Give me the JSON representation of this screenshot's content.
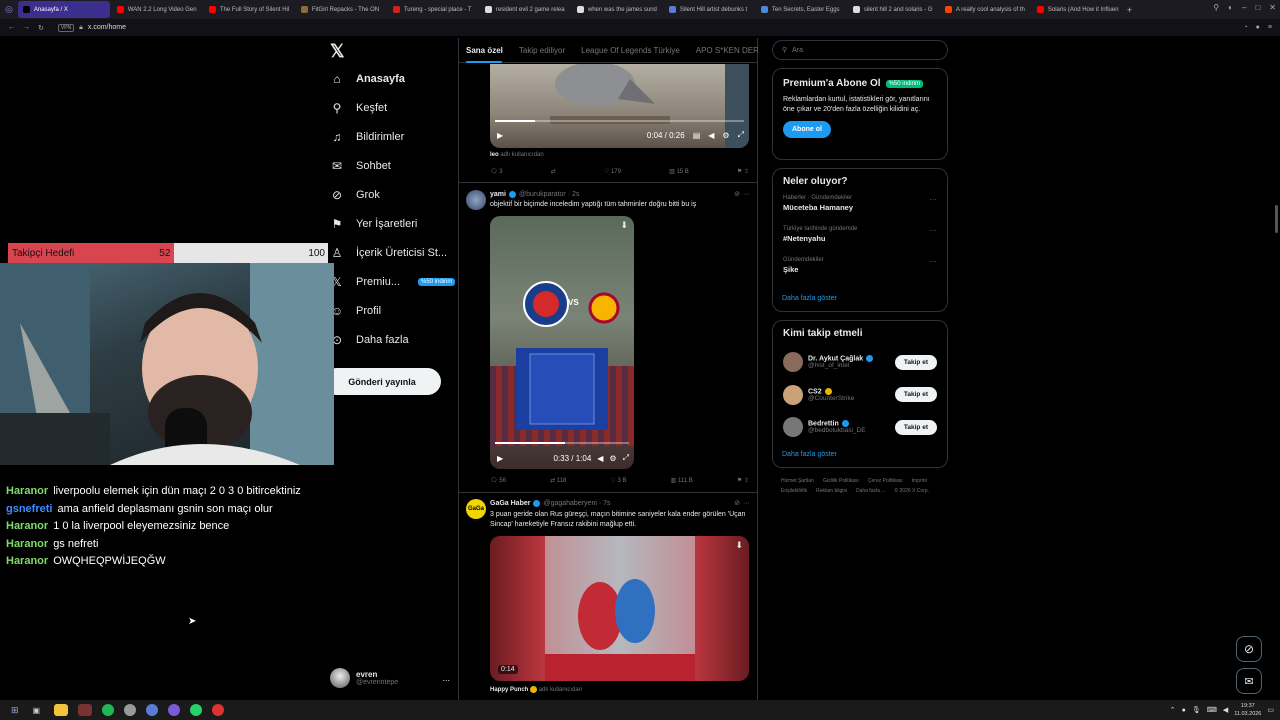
{
  "browser": {
    "tabs": [
      {
        "title": "Anasayfa / X",
        "color": "#000000",
        "active": true
      },
      {
        "title": "WAN 2.2 Long Video Gen",
        "color": "#ff0000"
      },
      {
        "title": "The Full Story of Silent Hil",
        "color": "#ff0000"
      },
      {
        "title": "FitGirl Repacks - The ON",
        "color": "#8a6d3b"
      },
      {
        "title": "Tureng - special place - T",
        "color": "#cc2222"
      },
      {
        "title": "resident evil 2 game relea",
        "color": "#dddddd"
      },
      {
        "title": "when was the james sund",
        "color": "#dddddd"
      },
      {
        "title": "Silent Hill artist debunks t",
        "color": "#5a7bd8"
      },
      {
        "title": "Ten Secrets, Easter Eggs",
        "color": "#4a8ad8"
      },
      {
        "title": "silent hill 2 and solaris - G",
        "color": "#dddddd"
      },
      {
        "title": "A really cool analysis of th",
        "color": "#ff4500"
      },
      {
        "title": "Solaris (And How it Influen",
        "color": "#ff0000"
      }
    ],
    "vpn": "VPN",
    "url": "x.com/home"
  },
  "sidebar": {
    "nav": [
      {
        "label": "Anasayfa",
        "icon": "home-icon",
        "glyph": "⌂",
        "bold": true
      },
      {
        "label": "Keşfet",
        "icon": "search-icon",
        "glyph": "⚲"
      },
      {
        "label": "Bildirimler",
        "icon": "bell-icon",
        "glyph": "♫"
      },
      {
        "label": "Sohbet",
        "icon": "mail-icon",
        "glyph": "✉"
      },
      {
        "label": "Grok",
        "icon": "grok-icon",
        "glyph": "⊘"
      },
      {
        "label": "Yer İşaretleri",
        "icon": "bookmark-icon",
        "glyph": "⚑"
      },
      {
        "label": "İçerik Üreticisi St...",
        "icon": "creator-icon",
        "glyph": "♙"
      },
      {
        "label": "Premiu...",
        "icon": "x-logo-icon",
        "glyph": "𝕏",
        "badge": "%50 indirim"
      },
      {
        "label": "Profil",
        "icon": "profile-icon",
        "glyph": "☺"
      },
      {
        "label": "Daha fazla",
        "icon": "more-circle-icon",
        "glyph": "⊙"
      }
    ],
    "post_button": "Gönderi yayınla",
    "account": {
      "name": "evren",
      "handle": "@evrenntepe",
      "more": "..."
    }
  },
  "overlay": {
    "follow_goal": {
      "label": "Takipçi Hedefi",
      "current": "52",
      "target": "100",
      "progress": 0.52
    },
    "chat": [
      {
        "user": "Haranor",
        "user_color": "#7fdc6b",
        "text": "liverpoolu elemek için dün maçı 2 0 3 0 bitircektiniz"
      },
      {
        "user": "gsnefreti",
        "user_color": "#3b8dff",
        "text": "ama anfield deplasmanı gsnin son maçı olur"
      },
      {
        "user": "Haranor",
        "user_color": "#7fdc6b",
        "text": "1 0 la liverpool eleyemezsiniz bence"
      },
      {
        "user": "Haranor",
        "user_color": "#7fdc6b",
        "text": "gs nefreti"
      },
      {
        "user": "Haranor",
        "user_color": "#7fdc6b",
        "text": "OWQHEQPWİJEQĞW"
      }
    ]
  },
  "feed": {
    "tabs": [
      "Sana özel",
      "Takip ediliyor",
      "League Of Legends Türkiye",
      "APO S*KEN DERNE"
    ],
    "post1": {
      "time": "0:04 / 0:26",
      "caption_user": "leo",
      "caption_rest": "adlı kullanıcıdan",
      "metrics": {
        "replies": "3",
        "reposts": "",
        "likes": "179",
        "views": "15 B"
      }
    },
    "post2": {
      "name": "yami",
      "handle": "@burukparator · 2s",
      "text": "objektif bir biçimde inceledim yaptığı tüm tahminler doğru bitti bu iş",
      "time": "0:33 / 1:04",
      "vs": "VS",
      "metrics": {
        "replies": "56",
        "reposts": "118",
        "likes": "3 B",
        "views": "111 B"
      }
    },
    "post3": {
      "name": "GaGa Haber",
      "handle": "@gagahaberyeni · 7s",
      "text": "3 puan geride olan Rus güreşçi, maçın bitimine saniyeler kala ender görülen 'Uçan Sincap' hareketiyle Fransız rakibini mağlup etti.",
      "duration": "0:14",
      "caption_user": "Happy Punch",
      "caption_rest": "adlı kullanıcıdan"
    }
  },
  "right": {
    "search_placeholder": "Ara",
    "premium": {
      "title": "Premium'a Abone Ol",
      "badge": "%50 indirim",
      "body": "Reklamlardan kurtul, istatistikleri gör, yanıtlarını öne çıkar ve 20'den fazla özelliğin kilidini aç.",
      "button": "Abone ol"
    },
    "trends": {
      "title": "Neler oluyor?",
      "items": [
        {
          "meta": "Haberler · Gündemdekiler",
          "name": "Müceteba Hamaney"
        },
        {
          "meta": "Türkiye tarihinde gündemde",
          "name": "#Netenyahu"
        },
        {
          "meta": "Gündemdekiler",
          "name": "Şike"
        }
      ],
      "more": "Daha fazla göster"
    },
    "who_to_follow": {
      "title": "Kimi takip etmeli",
      "users": [
        {
          "name": "Dr. Aykut Çağlak",
          "handle": "@hist_of_intel",
          "button": "Takip et",
          "avatar": "#8a6a5a"
        },
        {
          "name": "CS2",
          "handle": "@CounterStrike",
          "button": "Takip et",
          "avatar": "#c9a27a"
        },
        {
          "name": "Bedrettin",
          "handle": "@bedbolukbasi_DE",
          "button": "Takip et",
          "avatar": "#777777"
        }
      ],
      "more": "Daha fazla göster"
    },
    "footer": [
      "Hizmet Şartları",
      "Gizlilik Politikası",
      "Çerez Politikası",
      "Imprint",
      "Erişilebilirlik",
      "Reklam bilgisi",
      "Daha fazla ...",
      "© 2026 X Corp."
    ]
  },
  "taskbar": {
    "time": "19:37",
    "date": "11.03.2026"
  },
  "colors": {
    "accent": "#1d9bf0",
    "follow_bar_fill": "#d9454f",
    "badge_green": "#00ba7c"
  }
}
